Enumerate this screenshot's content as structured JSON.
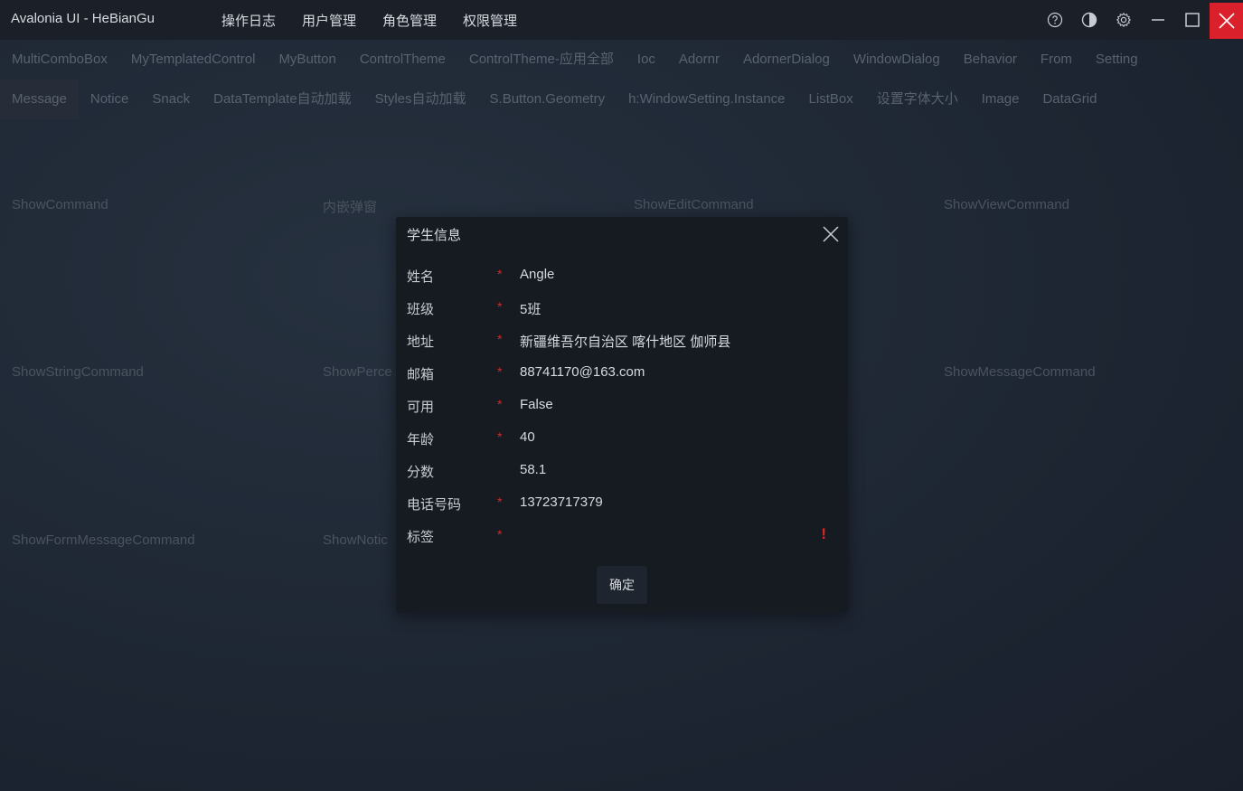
{
  "app": {
    "title": "Avalonia UI - HeBianGu"
  },
  "top_menu": [
    "操作日志",
    "用户管理",
    "角色管理",
    "权限管理"
  ],
  "window_controls": {
    "icons": [
      "help-icon",
      "theme-icon",
      "settings-icon",
      "minimize-icon",
      "maximize-icon",
      "close-icon"
    ],
    "close_color": "#d9202b"
  },
  "tabs_row1": [
    "MultiComboBox",
    "MyTemplatedControl",
    "MyButton",
    "ControlTheme",
    "ControlTheme-应用全部",
    "Ioc",
    "Adornr",
    "AdornerDialog",
    "WindowDialog",
    "Behavior",
    "From",
    "Setting"
  ],
  "tabs_row2": [
    "Message",
    "Notice",
    "Snack",
    "DataTemplate自动加载",
    "Styles自动加载",
    "S.Button.Geometry",
    "h:WindowSetting.Instance",
    "ListBox",
    "设置字体大小",
    "Image",
    "DataGrid"
  ],
  "active_tab": "Message",
  "commands": {
    "c1": "ShowCommand",
    "c2": "内嵌弹窗",
    "c3": "ShowEditCommand",
    "c4": "ShowViewCommand",
    "c5": "ShowStringCommand",
    "c6": "ShowPerce",
    "c7": "ShowMessageCommand",
    "c8": "ShowFormMessageCommand",
    "c9": "ShowNotic"
  },
  "dialog": {
    "title": "学生信息",
    "required_mark": "*",
    "fields": [
      {
        "label": "姓名",
        "value": "Angle",
        "required": true
      },
      {
        "label": "班级",
        "value": "5班",
        "required": true
      },
      {
        "label": "地址",
        "value": "新疆维吾尔自治区 喀什地区 伽师县",
        "required": true
      },
      {
        "label": "邮箱",
        "value": "88741170@163.com",
        "required": true
      },
      {
        "label": "可用",
        "value": "False",
        "required": true
      },
      {
        "label": "年龄",
        "value": "40",
        "required": true
      },
      {
        "label": "分数",
        "value": "58.1",
        "required": false
      },
      {
        "label": "电话号码",
        "value": "13723717379",
        "required": true
      },
      {
        "label": "标签",
        "value": "",
        "required": true
      }
    ],
    "error_mark": "!",
    "ok_label": "确定"
  }
}
